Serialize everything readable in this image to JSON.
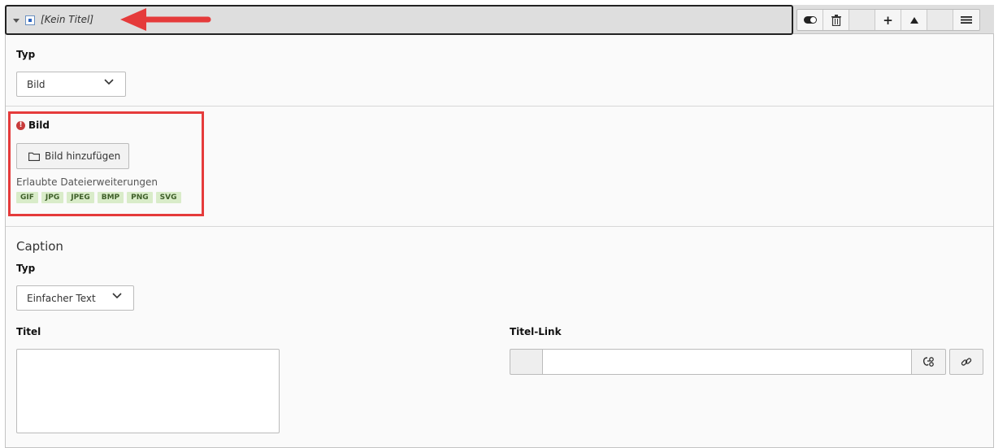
{
  "header": {
    "title": "[Kein Titel]",
    "arrow_color": "#e53b3b"
  },
  "typ_section": {
    "label": "Typ",
    "select_value": "Bild"
  },
  "bild_section": {
    "label": "Bild",
    "error_icon": "exclamation-circle-icon",
    "add_button_label": "Bild hinzufügen",
    "add_button_icon": "folder-icon",
    "allowed_label": "Erlaubte Dateierweiterungen",
    "extensions": [
      "GIF",
      "JPG",
      "JPEG",
      "BMP",
      "PNG",
      "SVG"
    ],
    "highlight_color": "#e53b3b"
  },
  "caption_section": {
    "heading": "Caption",
    "typ_label": "Typ",
    "typ_value": "Einfacher Text",
    "titel_label": "Titel",
    "titel_value": "",
    "titel_link_label": "Titel-Link",
    "titel_link_value": ""
  }
}
